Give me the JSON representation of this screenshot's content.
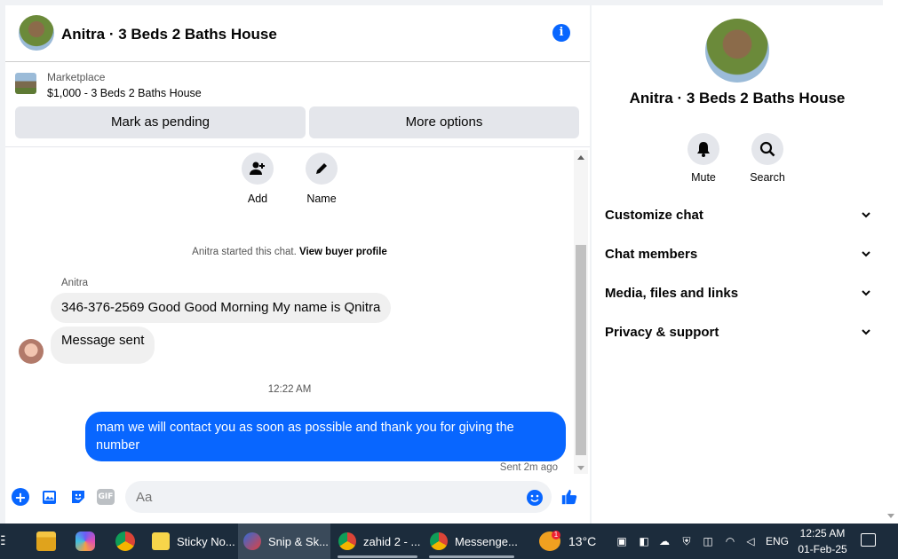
{
  "chat": {
    "title": "Anitra · 3 Beds 2 Baths House",
    "marketplace_label": "Marketplace",
    "listing_title": "$1,000 - 3 Beds 2 Baths House",
    "mark_pending_label": "Mark as pending",
    "more_options_label": "More options",
    "actions": {
      "add_label": "Add",
      "name_label": "Name"
    },
    "start_note": "Anitra started this chat.",
    "view_profile_label": "View buyer profile",
    "sender_name": "Anitra",
    "messages_in": [
      "346-376-2569 Good Good Morning My name is Qnitra",
      "Message sent"
    ],
    "time_separator": "12:22 AM",
    "message_out": "mam we will contact you as soon as possible and thank you for giving the number",
    "sent_status": "Sent 2m ago",
    "input_placeholder": "Aa",
    "gif_label": "GIF"
  },
  "right_panel": {
    "title": "Anitra · 3 Beds 2 Baths House",
    "mute_label": "Mute",
    "search_label": "Search",
    "rows": [
      "Customize chat",
      "Chat members",
      "Media, files and links",
      "Privacy & support"
    ]
  },
  "taskbar": {
    "apps": [
      "Sticky No...",
      "Snip & Sk...",
      "zahid 2 - ...",
      "Messenge..."
    ],
    "weather_badge": "1",
    "temperature": "13°C",
    "language": "ENG",
    "time": "12:25 AM",
    "date": "01-Feb-25"
  },
  "colors": {
    "accent": "#0866ff",
    "bubble_in": "#f0f0f0",
    "taskbar": "#1c2c3c"
  }
}
